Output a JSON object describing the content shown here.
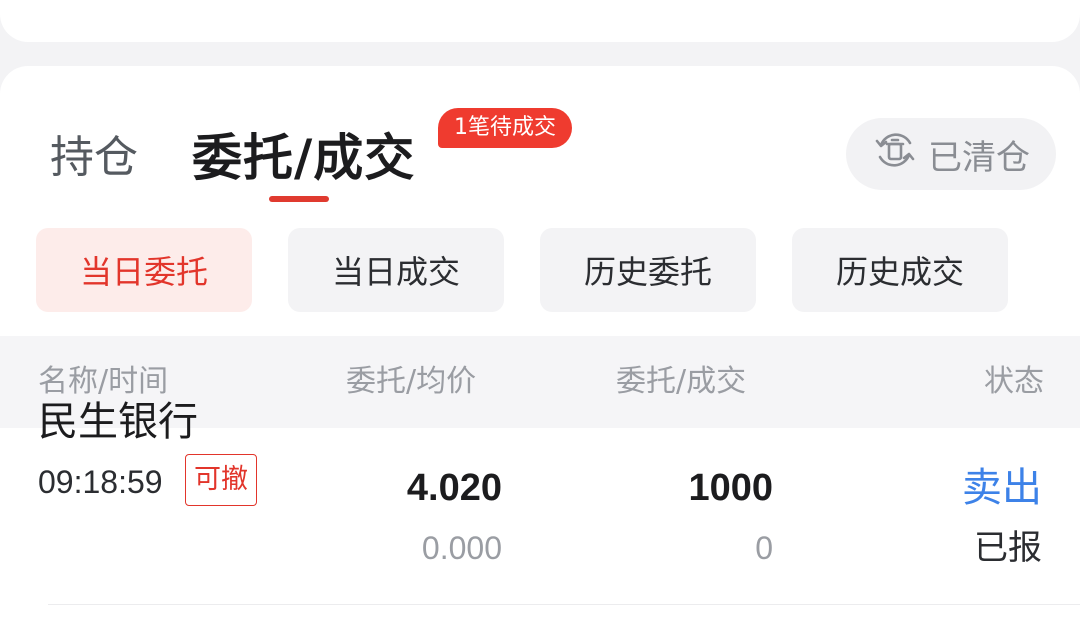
{
  "tabs": {
    "positions_label": "持仓",
    "orders_label": "委托/成交",
    "pending_badge": "1笔待成交"
  },
  "cleared_button": {
    "label": "已清仓",
    "icon": "cleared-history-icon"
  },
  "filters": [
    {
      "label": "当日委托",
      "active": true
    },
    {
      "label": "当日成交",
      "active": false
    },
    {
      "label": "历史委托",
      "active": false
    },
    {
      "label": "历史成交",
      "active": false
    }
  ],
  "table": {
    "headers": {
      "name_time": "名称/时间",
      "price": "委托/均价",
      "quantity": "委托/成交",
      "status": "状态"
    },
    "rows": [
      {
        "name": "民生银行",
        "time": "09:18:59",
        "cancel_tag": "可撤",
        "order_price": "4.020",
        "avg_price": "0.000",
        "order_qty": "1000",
        "filled_qty": "0",
        "action": "卖出",
        "state": "已报"
      }
    ]
  },
  "colors": {
    "accent_red": "#e2352b",
    "sell_blue": "#3d82e8",
    "badge_red": "#ef3b2f"
  }
}
